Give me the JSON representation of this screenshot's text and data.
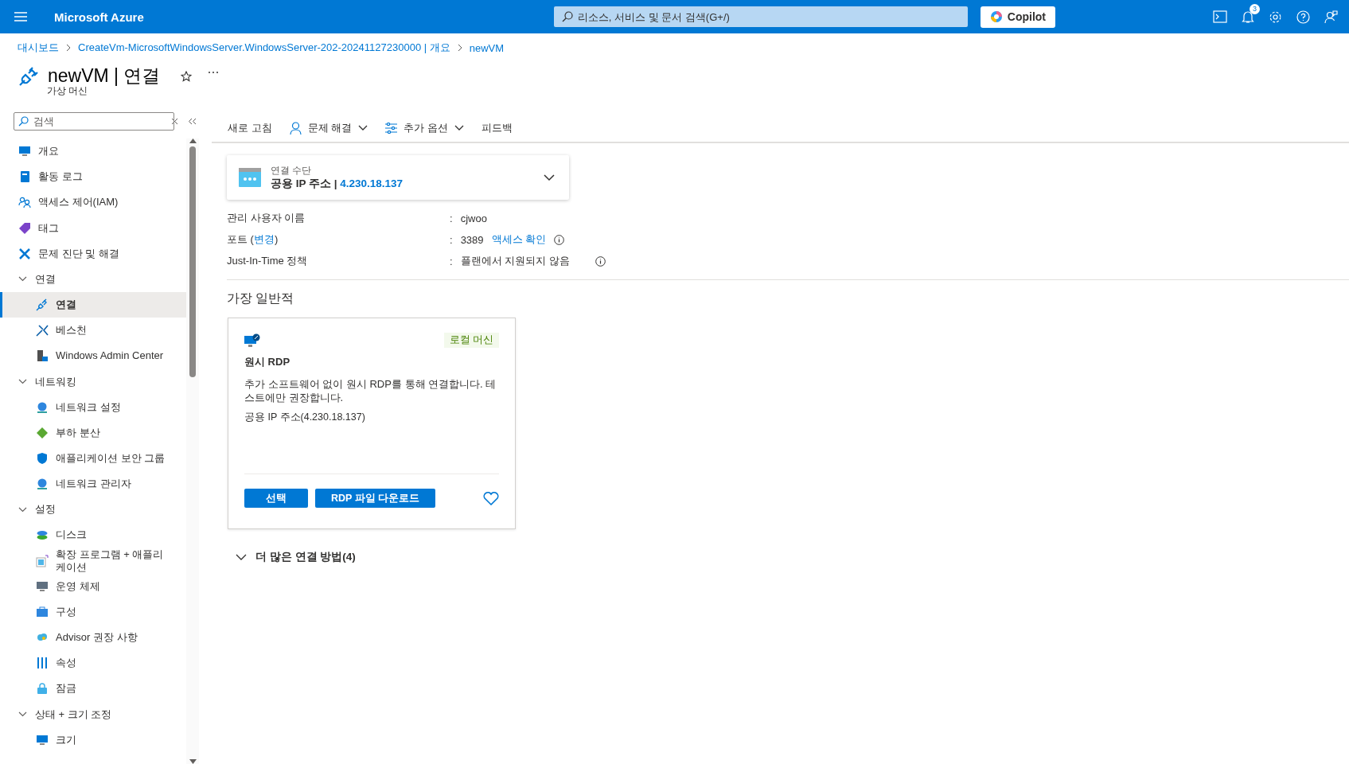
{
  "topbar": {
    "brand": "Microsoft Azure",
    "search": {
      "placeholder": "리소스, 서비스 및 문서 검색(G+/)"
    },
    "copilot": "Copilot",
    "notification_count": "3"
  },
  "breadcrumb": [
    "대시보드",
    "CreateVm-MicrosoftWindowsServer.WindowsServer-202-20241127230000 | 개요",
    "newVM"
  ],
  "header": {
    "title": "newVM | 연결",
    "subtitle": "가상 머신"
  },
  "sidebar": {
    "search": {
      "placeholder": "검색"
    },
    "items": [
      {
        "label": "개요",
        "selected": false
      },
      {
        "label": "활동 로그",
        "selected": false
      },
      {
        "label": "액세스 제어(IAM)",
        "selected": false
      },
      {
        "label": "태그",
        "selected": false
      },
      {
        "label": "문제 진단 및 해결",
        "selected": false
      },
      {
        "label": "연결",
        "expanded": true,
        "children": [
          {
            "label": "연결",
            "selected": true
          },
          {
            "label": "베스천",
            "selected": false
          },
          {
            "label": "Windows Admin Center",
            "selected": false
          }
        ]
      },
      {
        "label": "네트워킹",
        "expanded": true,
        "children": [
          {
            "label": "네트워크 설정",
            "selected": false
          },
          {
            "label": "부하 분산",
            "selected": false
          },
          {
            "label": "애플리케이션 보안 그룹",
            "selected": false
          },
          {
            "label": "네트워크 관리자",
            "selected": false
          }
        ]
      },
      {
        "label": "설정",
        "expanded": true,
        "children": [
          {
            "label": "디스크",
            "selected": false
          },
          {
            "label": "확장 프로그램 + 애플리케이션",
            "selected": false
          },
          {
            "label": "운영 체제",
            "selected": false
          },
          {
            "label": "구성",
            "selected": false
          },
          {
            "label": "Advisor 권장 사항",
            "selected": false
          },
          {
            "label": "속성",
            "selected": false
          },
          {
            "label": "잠금",
            "selected": false
          }
        ]
      },
      {
        "label": "상태 + 크기 조정",
        "expanded": true,
        "children": [
          {
            "label": "크기",
            "selected": false
          }
        ]
      }
    ]
  },
  "toolbar": [
    {
      "label": "새로 고침",
      "kind": "plain"
    },
    {
      "label": "문제 해결",
      "kind": "menu"
    },
    {
      "label": "추가 옵션",
      "kind": "menu"
    },
    {
      "label": "피드백",
      "kind": "plain"
    }
  ],
  "connect_via": {
    "label": "연결 수단",
    "value_label": "공용 IP 주소",
    "separator": "|",
    "value": "4.230.18.137"
  },
  "properties": [
    {
      "label": "관리 사용자 이름",
      "separator": ":",
      "value": "cjwoo",
      "info": false
    },
    {
      "label": "포트 (",
      "link": "변경",
      "label_end": ")",
      "separator": ":",
      "value": "3389",
      "action": "액세스 확인",
      "info": true
    },
    {
      "label": "Just-In-Time 정책",
      "separator": ":",
      "value": "플랜에서 지원되지 않음",
      "info": true
    }
  ],
  "section_title": "가장 일반적",
  "options": [
    {
      "title": "원시 RDP",
      "tag": "로컬 머신",
      "description": "추가 소프트웨어 없이 원시 RDP를 통해 연결합니다. 테스트에만 권장합니다.",
      "address": "공용 IP 주소(4.230.18.137)",
      "buttons": [
        "선택",
        "RDP 파일 다운로드"
      ],
      "favorite": false
    }
  ],
  "more": {
    "label": "더 많은 연결 방법(4)",
    "expanded": false
  }
}
